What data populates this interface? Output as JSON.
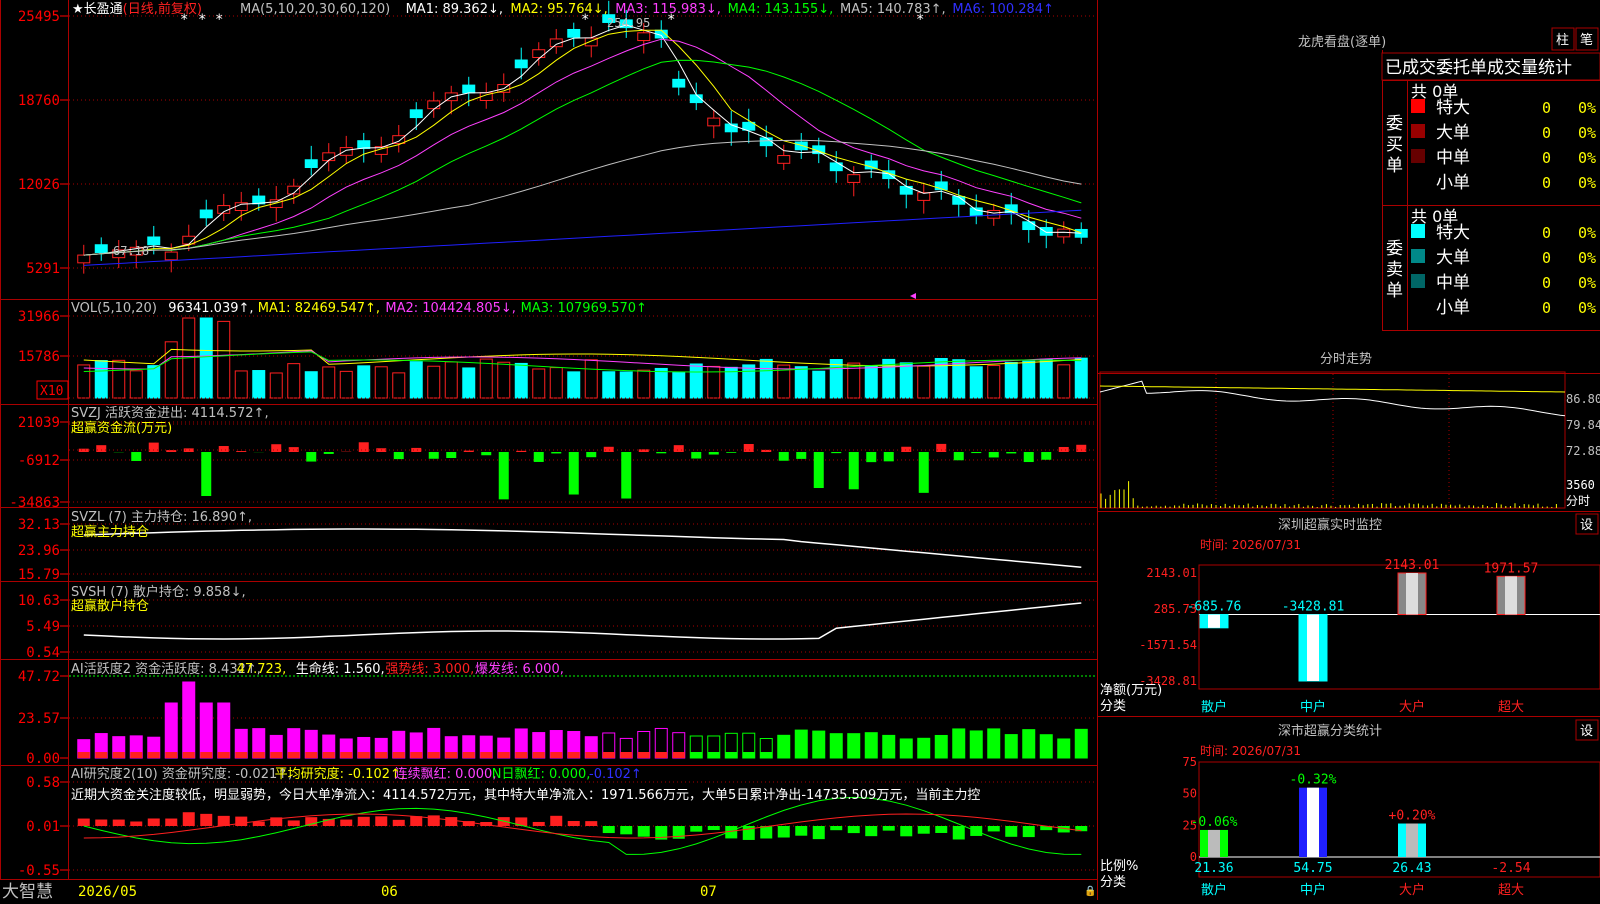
{
  "colors": {
    "up": "#ff2020",
    "down": "#00ffff",
    "ma1": "#ffffff",
    "ma2": "#ffff00",
    "ma3": "#ff40ff",
    "ma4": "#00ff00",
    "ma5": "#c0c0c0",
    "ma6": "#2020ff",
    "grid": "#aa0000",
    "axis": "#ff0000",
    "green": "#00ff00",
    "magenta": "#ff00ff",
    "yellow": "#ffff00",
    "cyan": "#00ffff",
    "white": "#ffffff"
  },
  "stock": {
    "name": "长盈通",
    "period": "(日线,前复权)",
    "max_label": "254.95",
    "min_label": "67.18"
  },
  "price_panel": {
    "legend": [
      {
        "text": "MA(5,10,20,30,60,120)",
        "color": "#c0c0c0"
      },
      {
        "text": "MA1: 89.362↓,",
        "color": "#ffffff"
      },
      {
        "text": "MA2: 95.764↓,",
        "color": "#ffff00"
      },
      {
        "text": "MA3: 115.983↓,",
        "color": "#ff40ff"
      },
      {
        "text": "MA4: 143.155↓,",
        "color": "#00ff00"
      },
      {
        "text": "MA5: 140.783↑,",
        "color": "#c0c0c0"
      },
      {
        "text": "MA6: 100.284↑",
        "color": "#3030ff"
      }
    ],
    "yticks": [
      "25495",
      "18760",
      "12026",
      "5291"
    ]
  },
  "vol_panel": {
    "legend": [
      {
        "text": "VOL(5,10,20)",
        "color": "#c0c0c0"
      },
      {
        "text": "96341.039↑,",
        "color": "#ffffff"
      },
      {
        "text": "MA1: 82469.547↑,",
        "color": "#ffff00"
      },
      {
        "text": "MA2: 104424.805↓,",
        "color": "#ff40ff"
      },
      {
        "text": "MA3: 107969.570↑",
        "color": "#00ff00"
      }
    ],
    "yticks": [
      "31966",
      "15786"
    ],
    "unit": "X10"
  },
  "svzj_panel": {
    "legend": [
      {
        "text": "SVZJ  活跃资金进出: 4114.572↑,",
        "color": "#c0c0c0"
      }
    ],
    "sub": "超赢资金流(万元)",
    "yticks": [
      "21039",
      "-6912",
      "-34863"
    ]
  },
  "svzl_panel": {
    "legend": [
      {
        "text": "SVZL (7) 主力持仓: 16.890↑,",
        "color": "#c0c0c0"
      }
    ],
    "sub": "超赢主力持仓",
    "yticks": [
      "32.13",
      "23.96",
      "15.79"
    ]
  },
  "svsh_panel": {
    "legend": [
      {
        "text": "SVSH (7) 散户持仓: 9.858↓,",
        "color": "#c0c0c0"
      }
    ],
    "sub": "超赢散户持仓",
    "yticks": [
      "10.63",
      "5.49",
      "0.54"
    ]
  },
  "ai_panel": {
    "legend": [
      {
        "text": "AI活跃度2 资金活跃度: 8.432↑,",
        "color": "#c0c0c0"
      },
      {
        "text": "47.723,",
        "color": "#ffff00"
      },
      {
        "text": "生命线: 1.560,",
        "color": "#ffffff"
      },
      {
        "text": "强势线: 3.000,",
        "color": "#ff2020"
      },
      {
        "text": "爆发线: 6.000,",
        "color": "#ff40ff"
      }
    ],
    "yticks": [
      "47.72",
      "23.57",
      "0.00"
    ]
  },
  "research_panel": {
    "legend": [
      {
        "text": "AI研究度2(10) 资金研究度: -0.021↑,",
        "color": "#c0c0c0"
      },
      {
        "text": "平均研究度: -0.102↑,",
        "color": "#ffff00"
      },
      {
        "text": "连续飘红: 0.000,",
        "color": "#ff40ff"
      },
      {
        "text": "N日飘红: 0.000,",
        "color": "#00ff00"
      },
      {
        "text": "-0.102↑",
        "color": "#3030ff"
      }
    ],
    "comment": "近期大资金关注度较低，明显弱势，今日大单净流入：4114.572万元，其中特大单净流入：1971.566万元，大单5日累计净出-14735.509万元，当前主力控",
    "yticks": [
      "0.58",
      "0.01",
      "-0.55"
    ]
  },
  "xaxis": {
    "months": [
      "2026/05",
      "06",
      "07"
    ]
  },
  "brand": "大智慧",
  "lhb": {
    "title": "龙虎看盘(逐单)",
    "btn1": "柱",
    "btn2": "笔",
    "tabs": "已成交委托单成交量统计",
    "buy": {
      "side": "委买单",
      "total": "共 0单",
      "rows": [
        {
          "label": "特大",
          "count": "0",
          "pct": "0%",
          "color": "#ff0000"
        },
        {
          "label": "大单",
          "count": "0",
          "pct": "0%",
          "color": "#990000"
        },
        {
          "label": "中单",
          "count": "0",
          "pct": "0%",
          "color": "#660000"
        },
        {
          "label": "小单",
          "count": "0",
          "pct": "0%",
          "color": "#000000"
        }
      ]
    },
    "sell": {
      "side": "委卖单",
      "total": "共 0单",
      "rows": [
        {
          "label": "特大",
          "count": "0",
          "pct": "0%",
          "color": "#00ffff"
        },
        {
          "label": "大单",
          "count": "0",
          "pct": "0%",
          "color": "#008888"
        },
        {
          "label": "中单",
          "count": "0",
          "pct": "0%",
          "color": "#006666"
        },
        {
          "label": "小单",
          "count": "0",
          "pct": "0%",
          "color": "#000000"
        }
      ]
    }
  },
  "intraday": {
    "title": "分时走势",
    "yticks": [
      "86.80",
      "79.84",
      "72.88"
    ],
    "vol_tick": "3560",
    "vol_unit": "分时"
  },
  "sz_monitor": {
    "title": "深圳超赢实时监控",
    "btn": "设",
    "time": "时间: 2026/07/31",
    "yticks": [
      "2143.01",
      "285.73",
      "-1571.54",
      "-3428.81"
    ],
    "ylabel": "净额(万元)",
    "xlabel": "分类",
    "bars": [
      {
        "cat": "散户",
        "value": -685.76,
        "label": "-685.76"
      },
      {
        "cat": "中户",
        "value": -3428.81,
        "label": "-3428.81"
      },
      {
        "cat": "大户",
        "value": 2143.01,
        "label": "2143.01"
      },
      {
        "cat": "超大",
        "value": 1971.57,
        "label": "1971.57"
      }
    ]
  },
  "sz_class": {
    "title": "深市超赢分类统计",
    "btn": "设",
    "time": "时间: 2026/07/31",
    "yticks": [
      "75",
      "50",
      "25",
      "0"
    ],
    "ylabel": "比例%",
    "xlabel": "分类",
    "bars": [
      {
        "cat": "散户",
        "value": 21.36,
        "label": "21.36",
        "delta": "-0.06%"
      },
      {
        "cat": "中户",
        "value": 54.75,
        "label": "54.75",
        "delta": "-0.32%"
      },
      {
        "cat": "大户",
        "value": 26.43,
        "label": "26.43",
        "delta": "+0.20%"
      },
      {
        "cat": "超大",
        "value": -2.54,
        "label": "-2.54",
        "delta": ""
      }
    ]
  }
}
